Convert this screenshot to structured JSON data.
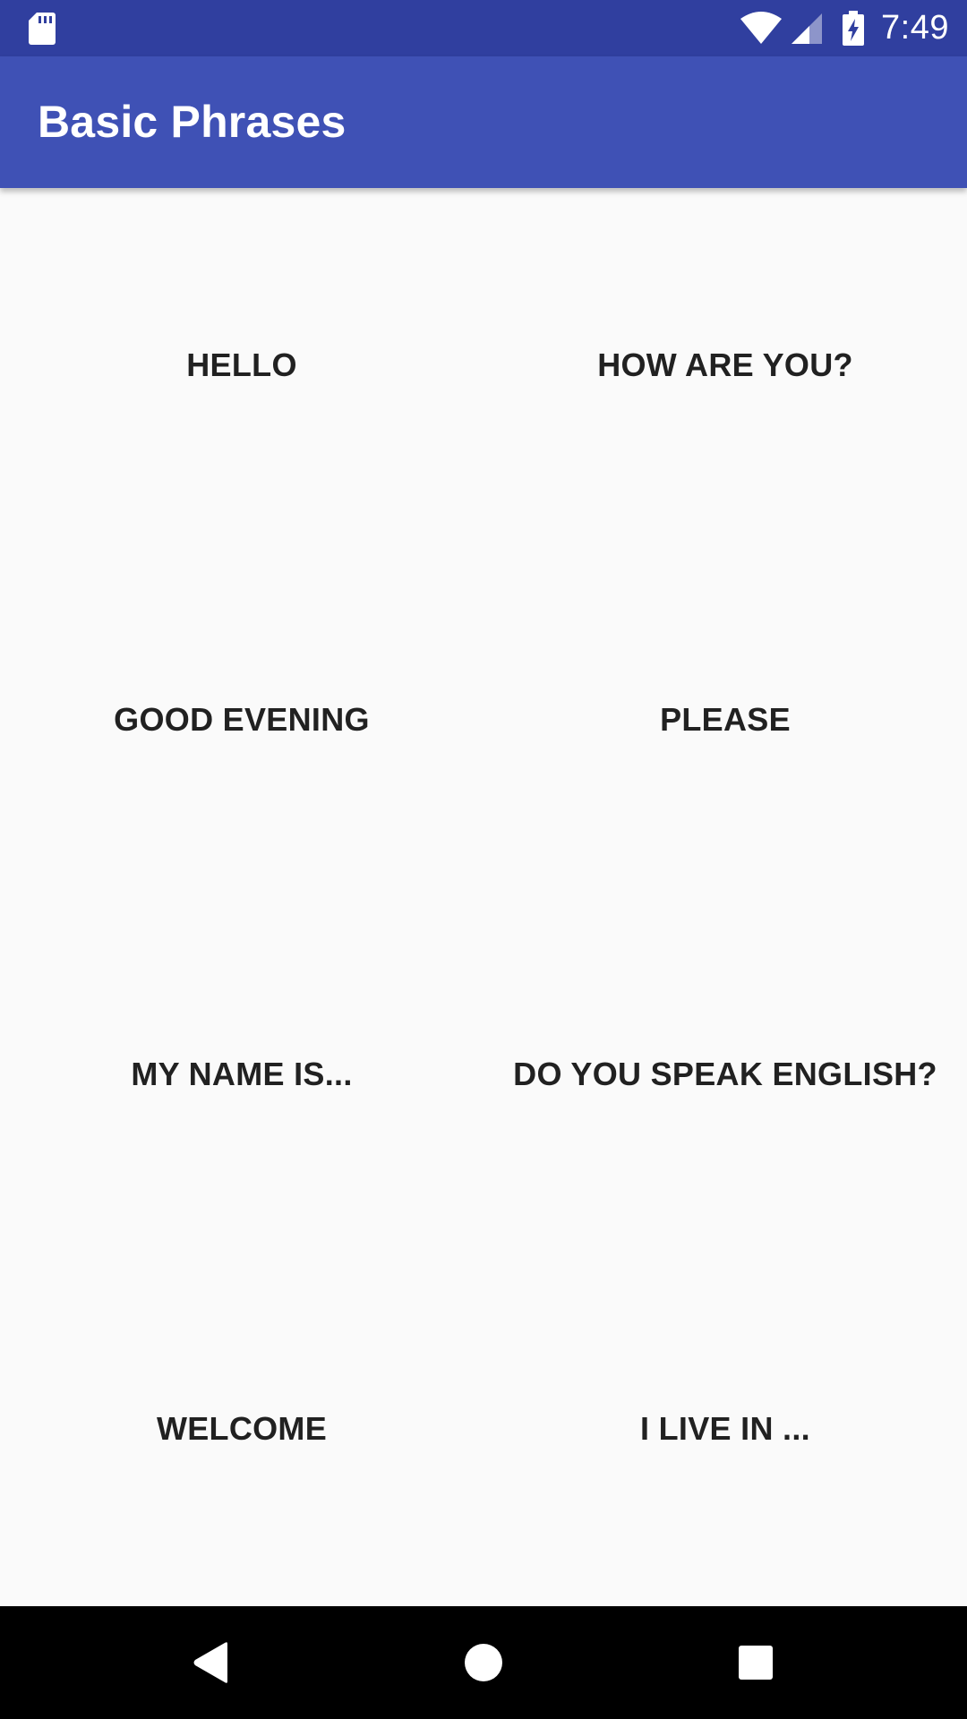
{
  "status_bar": {
    "time": "7:49",
    "icons": [
      "sd-card-icon",
      "wifi-icon",
      "signal-icon",
      "battery-charging-icon"
    ],
    "background": "#303f9f"
  },
  "app_bar": {
    "title": "Basic Phrases",
    "background": "#3f51b5"
  },
  "phrases": [
    "HELLO",
    "HOW ARE YOU?",
    "GOOD EVENING",
    "PLEASE",
    "MY NAME IS...",
    "DO YOU SPEAK ENGLISH?",
    "WELCOME",
    "I LIVE IN ..."
  ],
  "nav_bar": {
    "buttons": [
      "back-icon",
      "home-icon",
      "recents-icon"
    ],
    "background": "#000000"
  }
}
